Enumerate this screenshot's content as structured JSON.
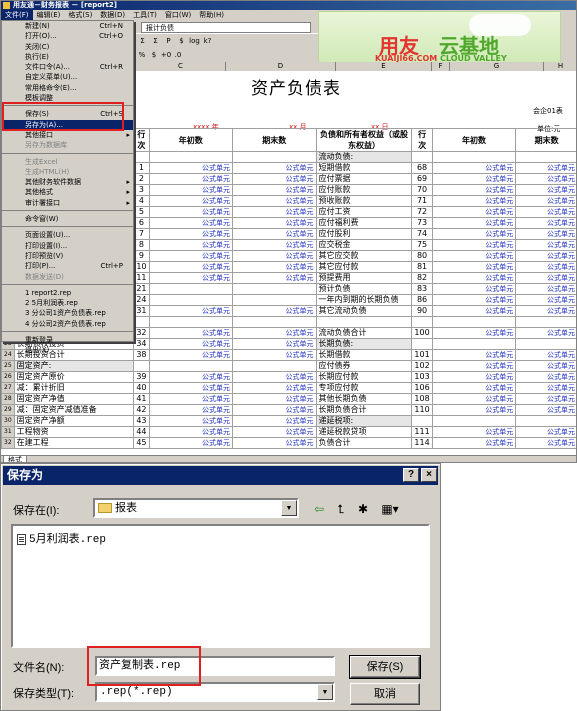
{
  "app": {
    "title": "用友通－财务报表 － [report2]",
    "menus": [
      "文件(F)",
      "编辑(E)",
      "格式(S)",
      "数据(D)",
      "工具(T)",
      "窗口(W)",
      "帮助(H)"
    ],
    "name_box": "报计负债",
    "toolbar_icons": [
      "Σ",
      "Σ",
      "P",
      "$",
      "log",
      "k?"
    ],
    "toolbar_icons2": [
      "%",
      "$",
      "+0",
      ".0"
    ]
  },
  "logo": {
    "brand_cn": "用友",
    "brand_cn2": "云基地",
    "domain": "KUAIJI66.COM",
    "slogan": "CLOUD VALLEY"
  },
  "file_menu": {
    "items": [
      {
        "label": "新建(N)",
        "shortcut": "Ctrl+N",
        "state": "normal"
      },
      {
        "label": "打开(O)...",
        "shortcut": "Ctrl+O",
        "state": "normal"
      },
      {
        "label": "关闭(C)",
        "shortcut": "",
        "state": "normal"
      },
      {
        "label": "执行(E)",
        "shortcut": "",
        "state": "normal"
      },
      {
        "label": "文件口令(A)...",
        "shortcut": "Ctrl+R",
        "state": "normal"
      },
      {
        "label": "自定义菜单(U)...",
        "shortcut": "",
        "state": "normal"
      },
      {
        "label": "常用格命令(E)...",
        "shortcut": "",
        "state": "normal"
      },
      {
        "label": "模板调整",
        "shortcut": "",
        "state": "normal"
      },
      {
        "sep": true
      },
      {
        "label": "保存(S)",
        "shortcut": "Ctrl+S",
        "state": "normal"
      },
      {
        "label": "另存为(A)...",
        "shortcut": "",
        "state": "selected"
      },
      {
        "label": "其他接口",
        "shortcut": "",
        "state": "normal",
        "submenu": true
      },
      {
        "label": "另存为数据库",
        "shortcut": "",
        "state": "disabled"
      },
      {
        "sep": true
      },
      {
        "label": "生成Excel",
        "shortcut": "",
        "state": "disabled"
      },
      {
        "label": "生成HTML(H)",
        "shortcut": "",
        "state": "disabled"
      },
      {
        "label": "其他财务软件数据",
        "shortcut": "",
        "state": "normal",
        "submenu": true
      },
      {
        "label": "其他格式",
        "shortcut": "",
        "state": "normal",
        "submenu": true
      },
      {
        "label": "审计署接口",
        "shortcut": "",
        "state": "normal",
        "submenu": true
      },
      {
        "sep": true
      },
      {
        "label": "命令窗(W)",
        "shortcut": "",
        "state": "normal"
      },
      {
        "sep": true
      },
      {
        "label": "页面设置(U)...",
        "shortcut": "",
        "state": "normal"
      },
      {
        "label": "打印设置(I)...",
        "shortcut": "",
        "state": "normal"
      },
      {
        "label": "打印预览(V)",
        "shortcut": "",
        "state": "normal"
      },
      {
        "label": "打印(P)...",
        "shortcut": "Ctrl+P",
        "state": "normal"
      },
      {
        "label": "数据发送(D)",
        "shortcut": "",
        "state": "disabled"
      },
      {
        "sep": true
      },
      {
        "label": "1 report2.rep",
        "shortcut": "",
        "state": "normal"
      },
      {
        "label": "2 5月利润表.rep",
        "shortcut": "",
        "state": "normal"
      },
      {
        "label": "3 分公司1资产负债表.rep",
        "shortcut": "",
        "state": "normal"
      },
      {
        "label": "4 分公司2资产负债表.rep",
        "shortcut": "",
        "state": "normal"
      },
      {
        "sep": true
      },
      {
        "label": "重新登录",
        "shortcut": "",
        "state": "normal"
      },
      {
        "label": "退出(X)",
        "shortcut": "",
        "state": "normal"
      }
    ]
  },
  "sheet": {
    "columns": [
      "B",
      "C",
      "D",
      "E",
      "F",
      "G",
      "H"
    ],
    "title": "资产负债表",
    "note_right": "会企01表",
    "unit_right": "单位:元",
    "date_marks": [
      "xxxx 年",
      "xx 月",
      "xx 日"
    ],
    "headers": [
      "行次",
      "年初数",
      "期末数",
      "负债和所有者权益（或股东权益）",
      "行次",
      "年初数",
      "期末数"
    ],
    "formula_text": "公式单元",
    "rows": [
      {
        "rn": "",
        "left": "",
        "lno": "",
        "lf": false,
        "right": "流动负债:",
        "rno": "",
        "rf": false,
        "sec_r": true
      },
      {
        "rn": "",
        "left": "",
        "lno": "1",
        "lf": true,
        "right": "短期借款",
        "rno": "68",
        "rf": true
      },
      {
        "rn": "",
        "left": "",
        "lno": "2",
        "lf": true,
        "right": "应付票据",
        "rno": "69",
        "rf": true
      },
      {
        "rn": "",
        "left": "",
        "lno": "3",
        "lf": true,
        "right": "应付账款",
        "rno": "70",
        "rf": true
      },
      {
        "rn": "",
        "left": "",
        "lno": "4",
        "lf": true,
        "right": "预收账款",
        "rno": "71",
        "rf": true
      },
      {
        "rn": "",
        "left": "",
        "lno": "5",
        "lf": true,
        "right": "应付工资",
        "rno": "72",
        "rf": true
      },
      {
        "rn": "",
        "left": "",
        "lno": "6",
        "lf": true,
        "right": "应付福利费",
        "rno": "73",
        "rf": true
      },
      {
        "rn": "",
        "left": "",
        "lno": "7",
        "lf": true,
        "right": "应付股利",
        "rno": "74",
        "rf": true
      },
      {
        "rn": "",
        "left": "",
        "lno": "8",
        "lf": true,
        "right": "应交税金",
        "rno": "75",
        "rf": true
      },
      {
        "rn": "",
        "left": "",
        "lno": "9",
        "lf": true,
        "right": "其它应交款",
        "rno": "80",
        "rf": true
      },
      {
        "rn": "",
        "left": "",
        "lno": "10",
        "lf": true,
        "right": "其它应付款",
        "rno": "81",
        "rf": true
      },
      {
        "rn": "",
        "left": "",
        "lno": "11",
        "lf": true,
        "right": "预提费用",
        "rno": "82",
        "rf": true
      },
      {
        "rn": "",
        "left": "",
        "lno": "21",
        "lf": false,
        "right": "预计负债",
        "rno": "83",
        "rf": true
      },
      {
        "rn": "",
        "left": "",
        "lno": "24",
        "lf": false,
        "right": "一年内到期的长期负债",
        "rno": "86",
        "rf": true
      },
      {
        "rn": "",
        "left": "",
        "lno": "31",
        "lf": true,
        "right": "其它流动负债",
        "rno": "90",
        "rf": true
      },
      {
        "rn": "",
        "left": "",
        "lno": "",
        "lf": false,
        "right": "",
        "rno": "",
        "rf": false
      },
      {
        "rn": "",
        "left": "长期股权投资",
        "lno": "32",
        "lf": true,
        "right": "流动负债合计",
        "rno": "100",
        "rf": true
      },
      {
        "rn": "23",
        "left": "长期债权投资",
        "lno": "34",
        "lf": true,
        "right": "长期负债:",
        "rno": "",
        "rf": false,
        "sec_r": true
      },
      {
        "rn": "24",
        "left": "长期投资合计",
        "lno": "38",
        "lf": true,
        "right": "长期借款",
        "rno": "101",
        "rf": true
      },
      {
        "rn": "25",
        "left": "固定资产:",
        "lno": "",
        "lf": false,
        "right": "应付债券",
        "rno": "102",
        "rf": true,
        "sec_l": true
      },
      {
        "rn": "26",
        "left": "  固定资产原价",
        "lno": "39",
        "lf": true,
        "right": "长期应付款",
        "rno": "103",
        "rf": true
      },
      {
        "rn": "27",
        "left": "    减：累计折旧",
        "lno": "40",
        "lf": true,
        "right": "专项应付款",
        "rno": "106",
        "rf": true
      },
      {
        "rn": "28",
        "left": "  固定资产净值",
        "lno": "41",
        "lf": true,
        "right": "其他长期负债",
        "rno": "108",
        "rf": true
      },
      {
        "rn": "29",
        "left": "    减：固定资产减值准备",
        "lno": "42",
        "lf": true,
        "right": "长期负债合计",
        "rno": "110",
        "rf": true
      },
      {
        "rn": "30",
        "left": "  固定资产净额",
        "lno": "43",
        "lf": true,
        "right": "递延税项:",
        "rno": "",
        "rf": false,
        "sec_r": true
      },
      {
        "rn": "31",
        "left": "  工程物资",
        "lno": "44",
        "lf": true,
        "right": "递延税款贷项",
        "rno": "111",
        "rf": true
      },
      {
        "rn": "32",
        "left": "  在建工程",
        "lno": "45",
        "lf": true,
        "right": "负债合计",
        "rno": "114",
        "rf": true
      }
    ],
    "sheet_tab": "格式"
  },
  "dialog": {
    "title": "保存为",
    "help_btn": "?",
    "close_btn": "×",
    "save_in_label": "保存在(I):",
    "save_in_value": "报表",
    "files": [
      "5月利润表.rep"
    ],
    "filename_label": "文件名(N):",
    "filename_value": "资产复制表.rep",
    "filetype_label": "保存类型(T):",
    "filetype_value": ".rep(*.rep)",
    "save_button": "保存(S)",
    "cancel_button": "取消"
  }
}
